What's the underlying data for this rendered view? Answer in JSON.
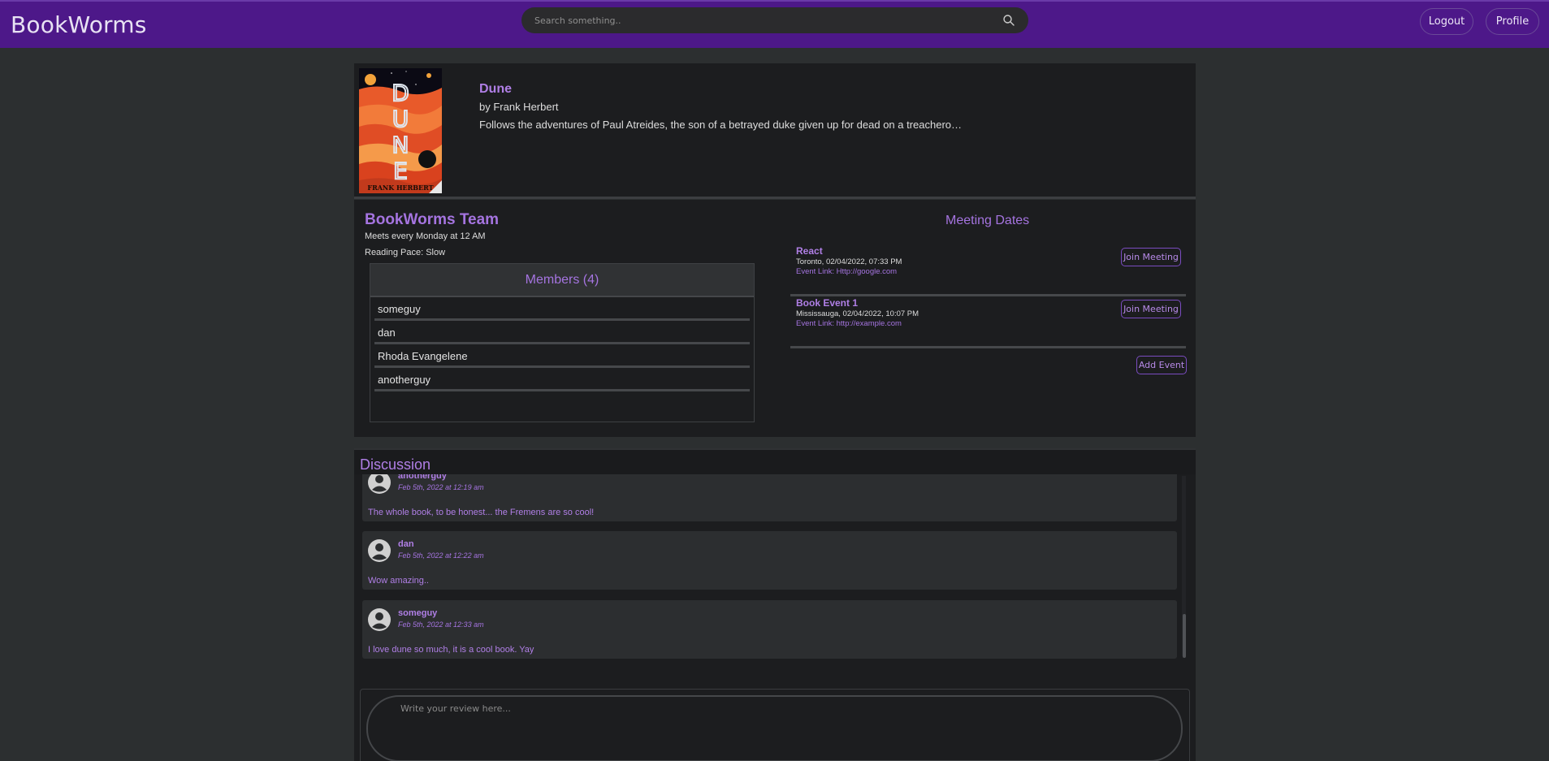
{
  "header": {
    "brand": "BookWorms",
    "search_placeholder": "Search something..",
    "logout_label": "Logout",
    "profile_label": "Profile",
    "accent_color": "#4d1889"
  },
  "book": {
    "title": "Dune",
    "author": "by Frank Herbert",
    "description": "Follows the adventures of Paul Atreides, the son of a betrayed duke given up for dead on a treachero…",
    "cover": {
      "title_text": "DUNE",
      "author_text": "FRANK HERBERT"
    }
  },
  "team": {
    "name": "BookWorms Team",
    "meets": "Meets every Monday at 12 AM",
    "pace": "Reading Pace: Slow",
    "members_header": "Members (4)",
    "members": [
      "someguy",
      "dan",
      "Rhoda Evangelene",
      "anotherguy"
    ]
  },
  "meetings": {
    "title": "Meeting Dates",
    "join_label": "Join Meeting",
    "add_event_label": "Add Event",
    "items": [
      {
        "name": "React",
        "location": "Toronto, 02/04/2022, 07:33 PM",
        "link": "Event Link: Http://google.com"
      },
      {
        "name": "Book Event 1",
        "location": "Mississauga, 02/04/2022, 10:07 PM",
        "link": "Event Link: http://example.com"
      }
    ]
  },
  "discussion": {
    "title": "Discussion",
    "review_placeholder": "Write your review here...",
    "posts": [
      {
        "user": "anotherguy",
        "date": "Feb 5th, 2022 at 12:19 am",
        "text": "The whole book, to be honest... the Fremens are so cool!"
      },
      {
        "user": "dan",
        "date": "Feb 5th, 2022 at 12:22 am",
        "text": "Wow amazing.."
      },
      {
        "user": "someguy",
        "date": "Feb 5th, 2022 at 12:33 am",
        "text": "I love dune so much, it is a cool book. Yay"
      }
    ]
  }
}
